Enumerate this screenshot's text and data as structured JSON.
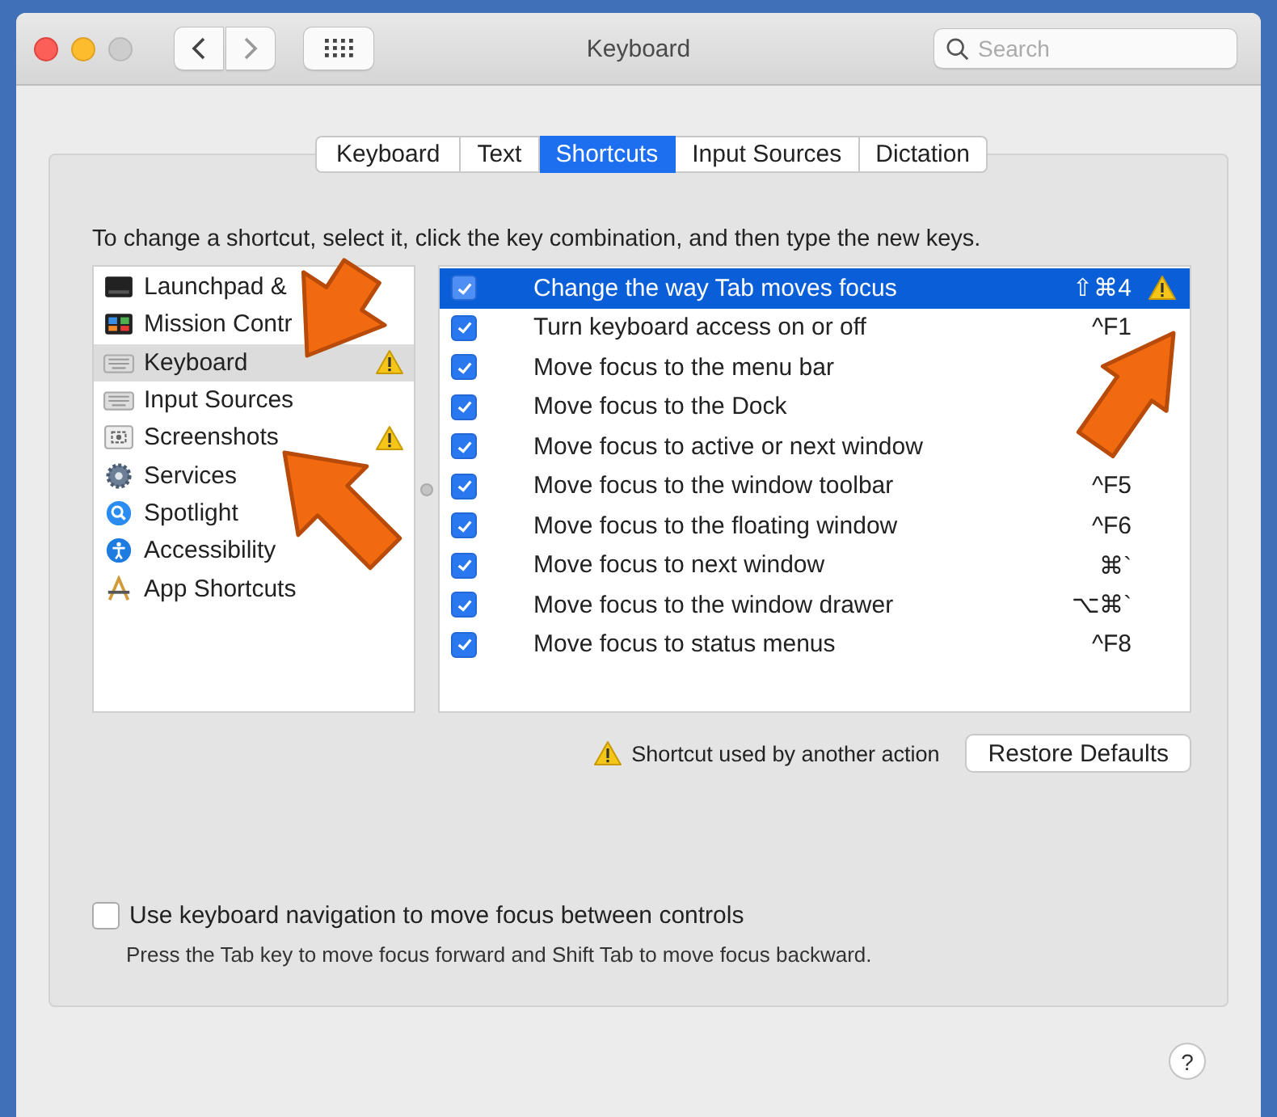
{
  "window": {
    "title": "Keyboard"
  },
  "search": {
    "placeholder": "Search"
  },
  "tabs": [
    {
      "label": "Keyboard",
      "selected": false
    },
    {
      "label": "Text",
      "selected": false
    },
    {
      "label": "Shortcuts",
      "selected": true
    },
    {
      "label": "Input Sources",
      "selected": false
    },
    {
      "label": "Dictation",
      "selected": false
    }
  ],
  "instruction": "To change a shortcut, select it, click the key combination, and then type the new keys.",
  "categories": [
    {
      "label": "Launchpad &",
      "selected": false,
      "warning": false
    },
    {
      "label": "Mission Contr",
      "selected": false,
      "warning": false
    },
    {
      "label": "Keyboard",
      "selected": true,
      "warning": true
    },
    {
      "label": "Input Sources",
      "selected": false,
      "warning": false
    },
    {
      "label": "Screenshots",
      "selected": false,
      "warning": true
    },
    {
      "label": "Services",
      "selected": false,
      "warning": false
    },
    {
      "label": "Spotlight",
      "selected": false,
      "warning": false
    },
    {
      "label": "Accessibility",
      "selected": false,
      "warning": false
    },
    {
      "label": "App Shortcuts",
      "selected": false,
      "warning": false
    }
  ],
  "shortcuts": [
    {
      "label": "Change the way Tab moves focus",
      "checked": true,
      "selected": true,
      "keys": "⇧⌘4",
      "warning": true
    },
    {
      "label": "Turn keyboard access on or off",
      "checked": true,
      "selected": false,
      "keys": "^F1",
      "warning": false
    },
    {
      "label": "Move focus to the menu bar",
      "checked": true,
      "selected": false,
      "warning": false
    },
    {
      "label": "Move focus to the Dock",
      "checked": true,
      "selected": false,
      "warning": false
    },
    {
      "label": "Move focus to active or next window",
      "checked": true,
      "selected": false,
      "warning": false
    },
    {
      "label": "Move focus to the window toolbar",
      "checked": true,
      "selected": false,
      "keys": "^F5",
      "warning": false
    },
    {
      "label": "Move focus to the floating window",
      "checked": true,
      "selected": false,
      "keys": "^F6",
      "warning": false
    },
    {
      "label": "Move focus to next window",
      "checked": true,
      "selected": false,
      "keys": "⌘`",
      "warning": false
    },
    {
      "label": "Move focus to the window drawer",
      "checked": true,
      "selected": false,
      "keys": "⌥⌘`",
      "warning": false
    },
    {
      "label": "Move focus to status menus",
      "checked": true,
      "selected": false,
      "keys": "^F8",
      "warning": false
    }
  ],
  "conflict_note": "Shortcut used by another action",
  "restore_button": "Restore Defaults",
  "keyboard_navigation": {
    "label": "Use keyboard navigation to move focus between controls",
    "checked": false,
    "hint": "Press the Tab key to move focus forward and Shift Tab to move focus backward."
  },
  "help_button": "?"
}
